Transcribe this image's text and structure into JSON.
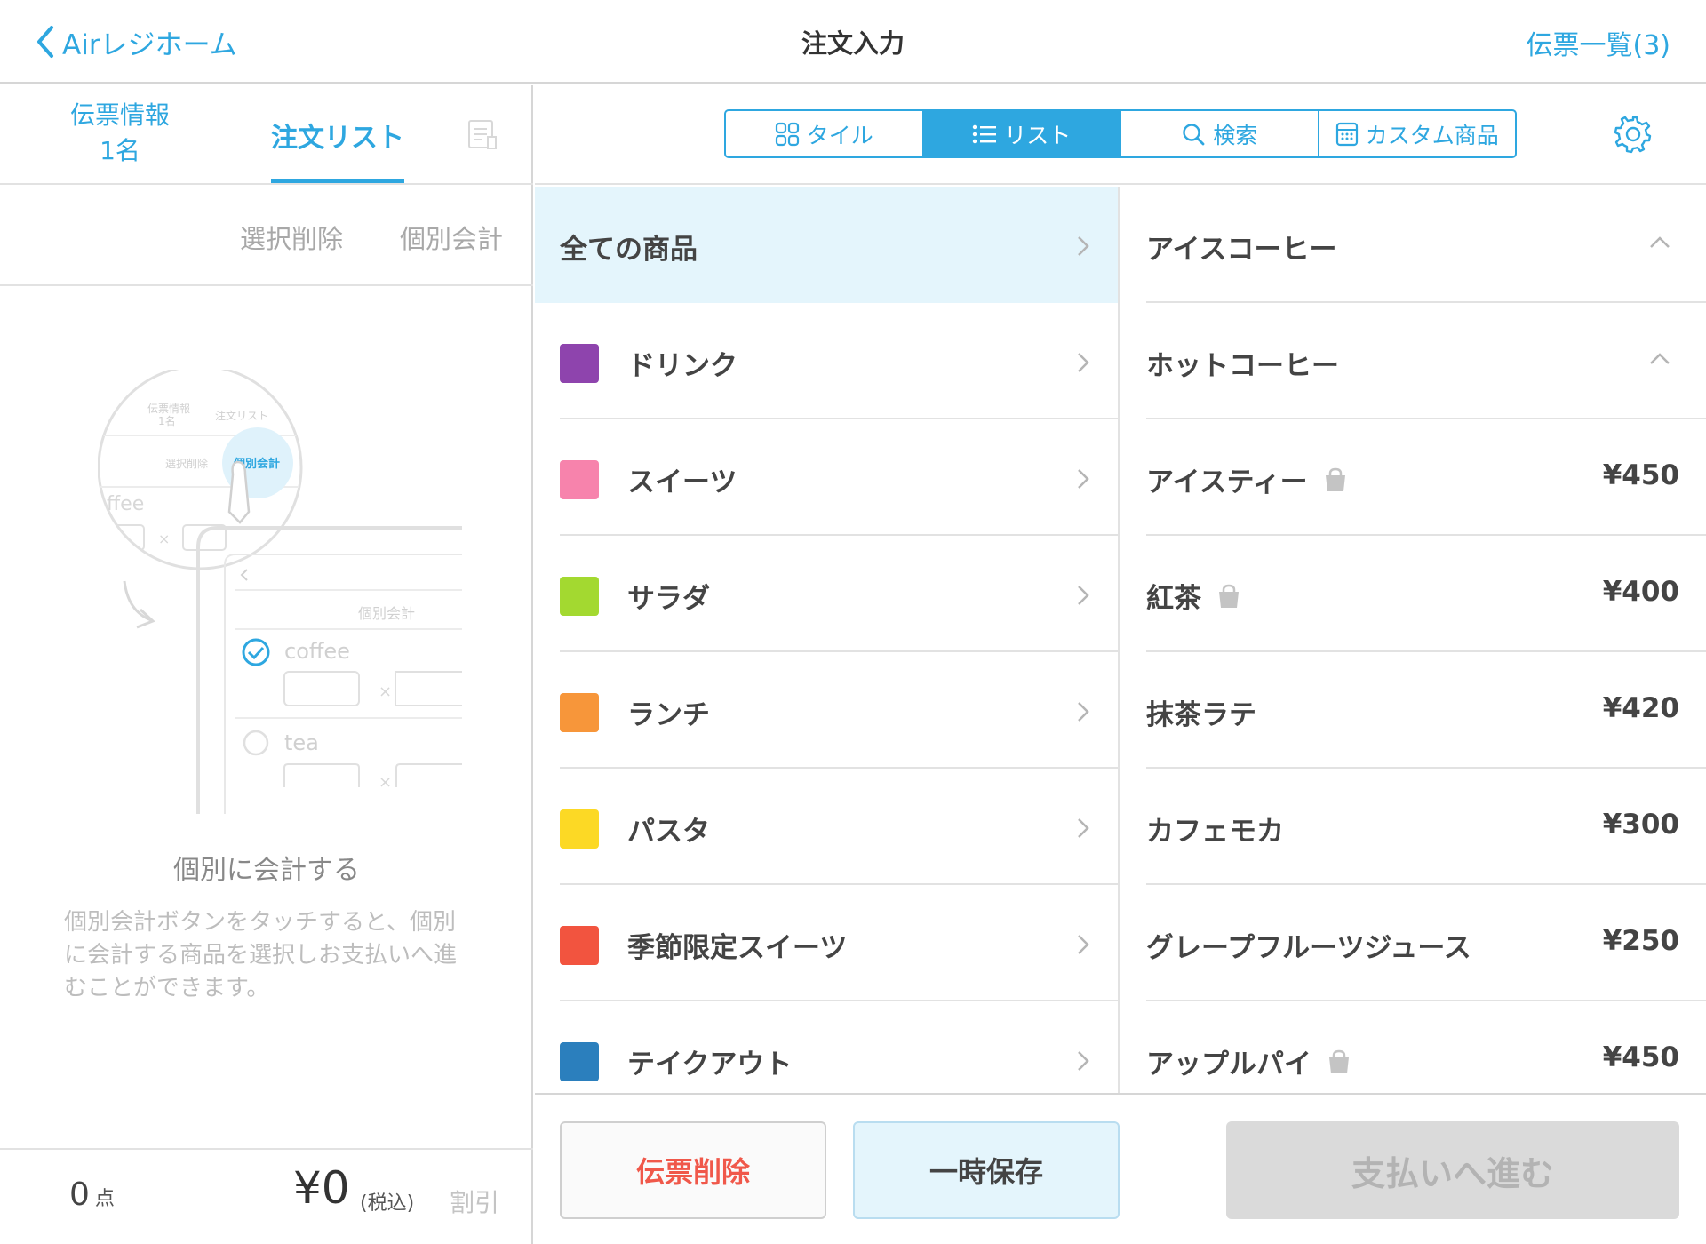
{
  "header": {
    "back_label": "Airレジホーム",
    "title": "注文入力",
    "slips_label": "伝票一覧(3)"
  },
  "left_tabs": {
    "info_line1": "伝票情報",
    "info_line2": "1名",
    "order_list": "注文リスト"
  },
  "left_actions": {
    "delete_selected": "選択削除",
    "split_pay": "個別会計"
  },
  "illustration": {
    "tab_info_line1": "伝票情報",
    "tab_info_line2": "1名",
    "tab_order": "注文リスト",
    "action_delete": "選択削除",
    "action_split": "個別会計",
    "item_partial": "ffee",
    "screen_action": "個別会計",
    "item1": "coffee",
    "item2": "tea",
    "times": "×"
  },
  "empty_state": {
    "title": "個別に会計する",
    "description": "個別会計ボタンをタッチすると、個別に会計する商品を選択しお支払いへ進むことができます。"
  },
  "footer_left": {
    "count": "0",
    "count_unit": "点",
    "total": "¥0",
    "tax_note": "(税込)",
    "discount": "割引"
  },
  "view_modes": [
    {
      "label": "タイル",
      "icon": "tile-icon",
      "active": false
    },
    {
      "label": "リスト",
      "icon": "list-icon",
      "active": true
    },
    {
      "label": "検索",
      "icon": "search-icon",
      "active": false
    },
    {
      "label": "カスタム商品",
      "icon": "calculator-icon",
      "active": false
    }
  ],
  "categories": [
    {
      "label": "全ての商品",
      "color": null,
      "active": true
    },
    {
      "label": "ドリンク",
      "color": "#8e44ad"
    },
    {
      "label": "スイーツ",
      "color": "#f783ac"
    },
    {
      "label": "サラダ",
      "color": "#a3d930"
    },
    {
      "label": "ランチ",
      "color": "#f7963a"
    },
    {
      "label": "パスタ",
      "color": "#fcd925"
    },
    {
      "label": "季節限定スイーツ",
      "color": "#f2543f"
    },
    {
      "label": "テイクアウト",
      "color": "#2b7fbd"
    }
  ],
  "items": [
    {
      "label": "アイスコーヒー",
      "price": "",
      "expandable": true,
      "takeout": false
    },
    {
      "label": "ホットコーヒー",
      "price": "",
      "expandable": true,
      "takeout": false
    },
    {
      "label": "アイスティー",
      "price": "¥450",
      "takeout": true
    },
    {
      "label": "紅茶",
      "price": "¥400",
      "takeout": true
    },
    {
      "label": "抹茶ラテ",
      "price": "¥420",
      "takeout": false
    },
    {
      "label": "カフェモカ",
      "price": "¥300",
      "takeout": false
    },
    {
      "label": "グレープフルーツジュース",
      "price": "¥250",
      "takeout": false
    },
    {
      "label": "アップルパイ",
      "price": "¥450",
      "takeout": true
    }
  ],
  "bottom_buttons": {
    "delete_slip": "伝票削除",
    "hold": "一時保存",
    "pay": "支払いへ進む"
  },
  "colors": {
    "accent": "#2ea7e0",
    "danger": "#f0584a"
  }
}
